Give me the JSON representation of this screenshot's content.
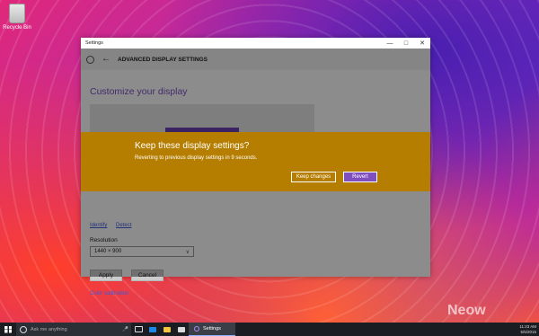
{
  "desktop": {
    "recycle_bin_label": "Recycle Bin"
  },
  "window": {
    "title": "Settings",
    "controls": {
      "minimize": "—",
      "maximize": "□",
      "close": "✕"
    },
    "header_title": "ADVANCED DISPLAY SETTINGS",
    "page_heading": "Customize your display",
    "links": {
      "identify": "Identify",
      "detect": "Detect"
    },
    "resolution_label": "Resolution",
    "resolution_value": "1440 × 900",
    "apply_label": "Apply",
    "cancel_label": "Cancel",
    "color_calibration_label": "Color calibration"
  },
  "dialog": {
    "title": "Keep these display settings?",
    "message": "Reverting to previous display settings in 9 seconds.",
    "keep_label": "Keep changes",
    "revert_label": "Revert"
  },
  "taskbar": {
    "search_placeholder": "Ask me anything",
    "active_app_label": "Settings",
    "tray_time": "11:23 AM",
    "tray_date": "5/5/2015"
  },
  "colors": {
    "dialog_bg": "#b57e00",
    "accent": "#7f4fc0",
    "taskbar_bg": "#1a1d22"
  }
}
